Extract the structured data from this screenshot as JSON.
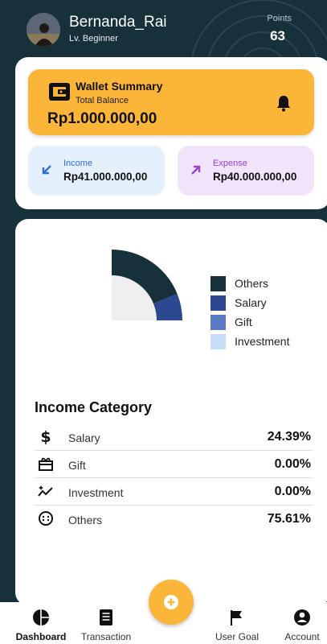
{
  "user": {
    "name": "Bernanda_Rai",
    "level": "Lv. Beginner",
    "points_label": "Points",
    "points_value": "63"
  },
  "wallet": {
    "title": "Wallet Summary",
    "subtitle": "Total Balance",
    "amount": "Rp1.000.000,00",
    "icon": "wallet-icon",
    "bell_icon": "bell-icon"
  },
  "income": {
    "label": "Income",
    "value": "Rp41.000.000,00",
    "color": "#2f6fd6"
  },
  "expense": {
    "label": "Expense",
    "value": "Rp40.000.000,00",
    "color": "#9b3fd0"
  },
  "chart_data": {
    "type": "pie",
    "categories": [
      "Others",
      "Salary",
      "Gift",
      "Investment"
    ],
    "values": [
      75.61,
      24.39,
      0.0,
      0.0
    ],
    "colors": [
      "#17313a",
      "#2d4890",
      "#5a7bc4",
      "#c8ddf5"
    ],
    "legend": "right"
  },
  "category": {
    "title": "Income Category",
    "rows": [
      {
        "name": "Salary",
        "percent": "24.39%",
        "icon": "dollar-icon"
      },
      {
        "name": "Gift",
        "percent": "0.00%",
        "icon": "gift-icon"
      },
      {
        "name": "Investment",
        "percent": "0.00%",
        "icon": "trend-icon"
      },
      {
        "name": "Others",
        "percent": "75.61%",
        "icon": "more-circle-icon"
      }
    ]
  },
  "nav": [
    {
      "label": "Dashboard",
      "icon": "pie-chart-icon",
      "active": true
    },
    {
      "label": "Transaction",
      "icon": "receipt-icon",
      "active": false
    },
    {
      "label": "User Goal",
      "icon": "flag-icon",
      "active": false
    },
    {
      "label": "Account",
      "icon": "account-icon",
      "active": false
    }
  ],
  "fab_icon": "plus-icon",
  "colors": {
    "primary": "#17313a",
    "accent": "#fbb63a"
  }
}
